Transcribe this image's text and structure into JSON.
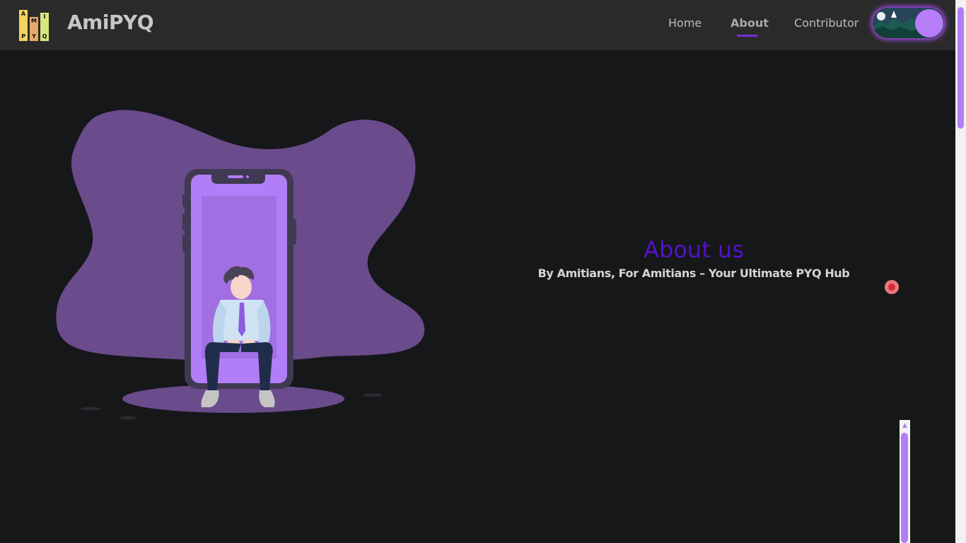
{
  "brand": {
    "name": "AmiPYQ",
    "logo_letters": [
      "A",
      "M",
      "I",
      "P",
      "Y",
      "Q"
    ]
  },
  "nav": {
    "items": [
      {
        "label": "Home"
      },
      {
        "label": "About"
      },
      {
        "label": "Contributor"
      }
    ],
    "active": "About"
  },
  "theme_toggle": {
    "state": "dark"
  },
  "about": {
    "heading": "About us",
    "tagline": "By Amitians, For Amitians – Your Ultimate PYQ Hub"
  },
  "colors": {
    "background": "#161719",
    "navbar": "#2a2a2b",
    "accent": "#7b2ad9",
    "heading": "#5312c8",
    "blob": "#6a4b8c",
    "phone_screen": "#b27ef7"
  }
}
